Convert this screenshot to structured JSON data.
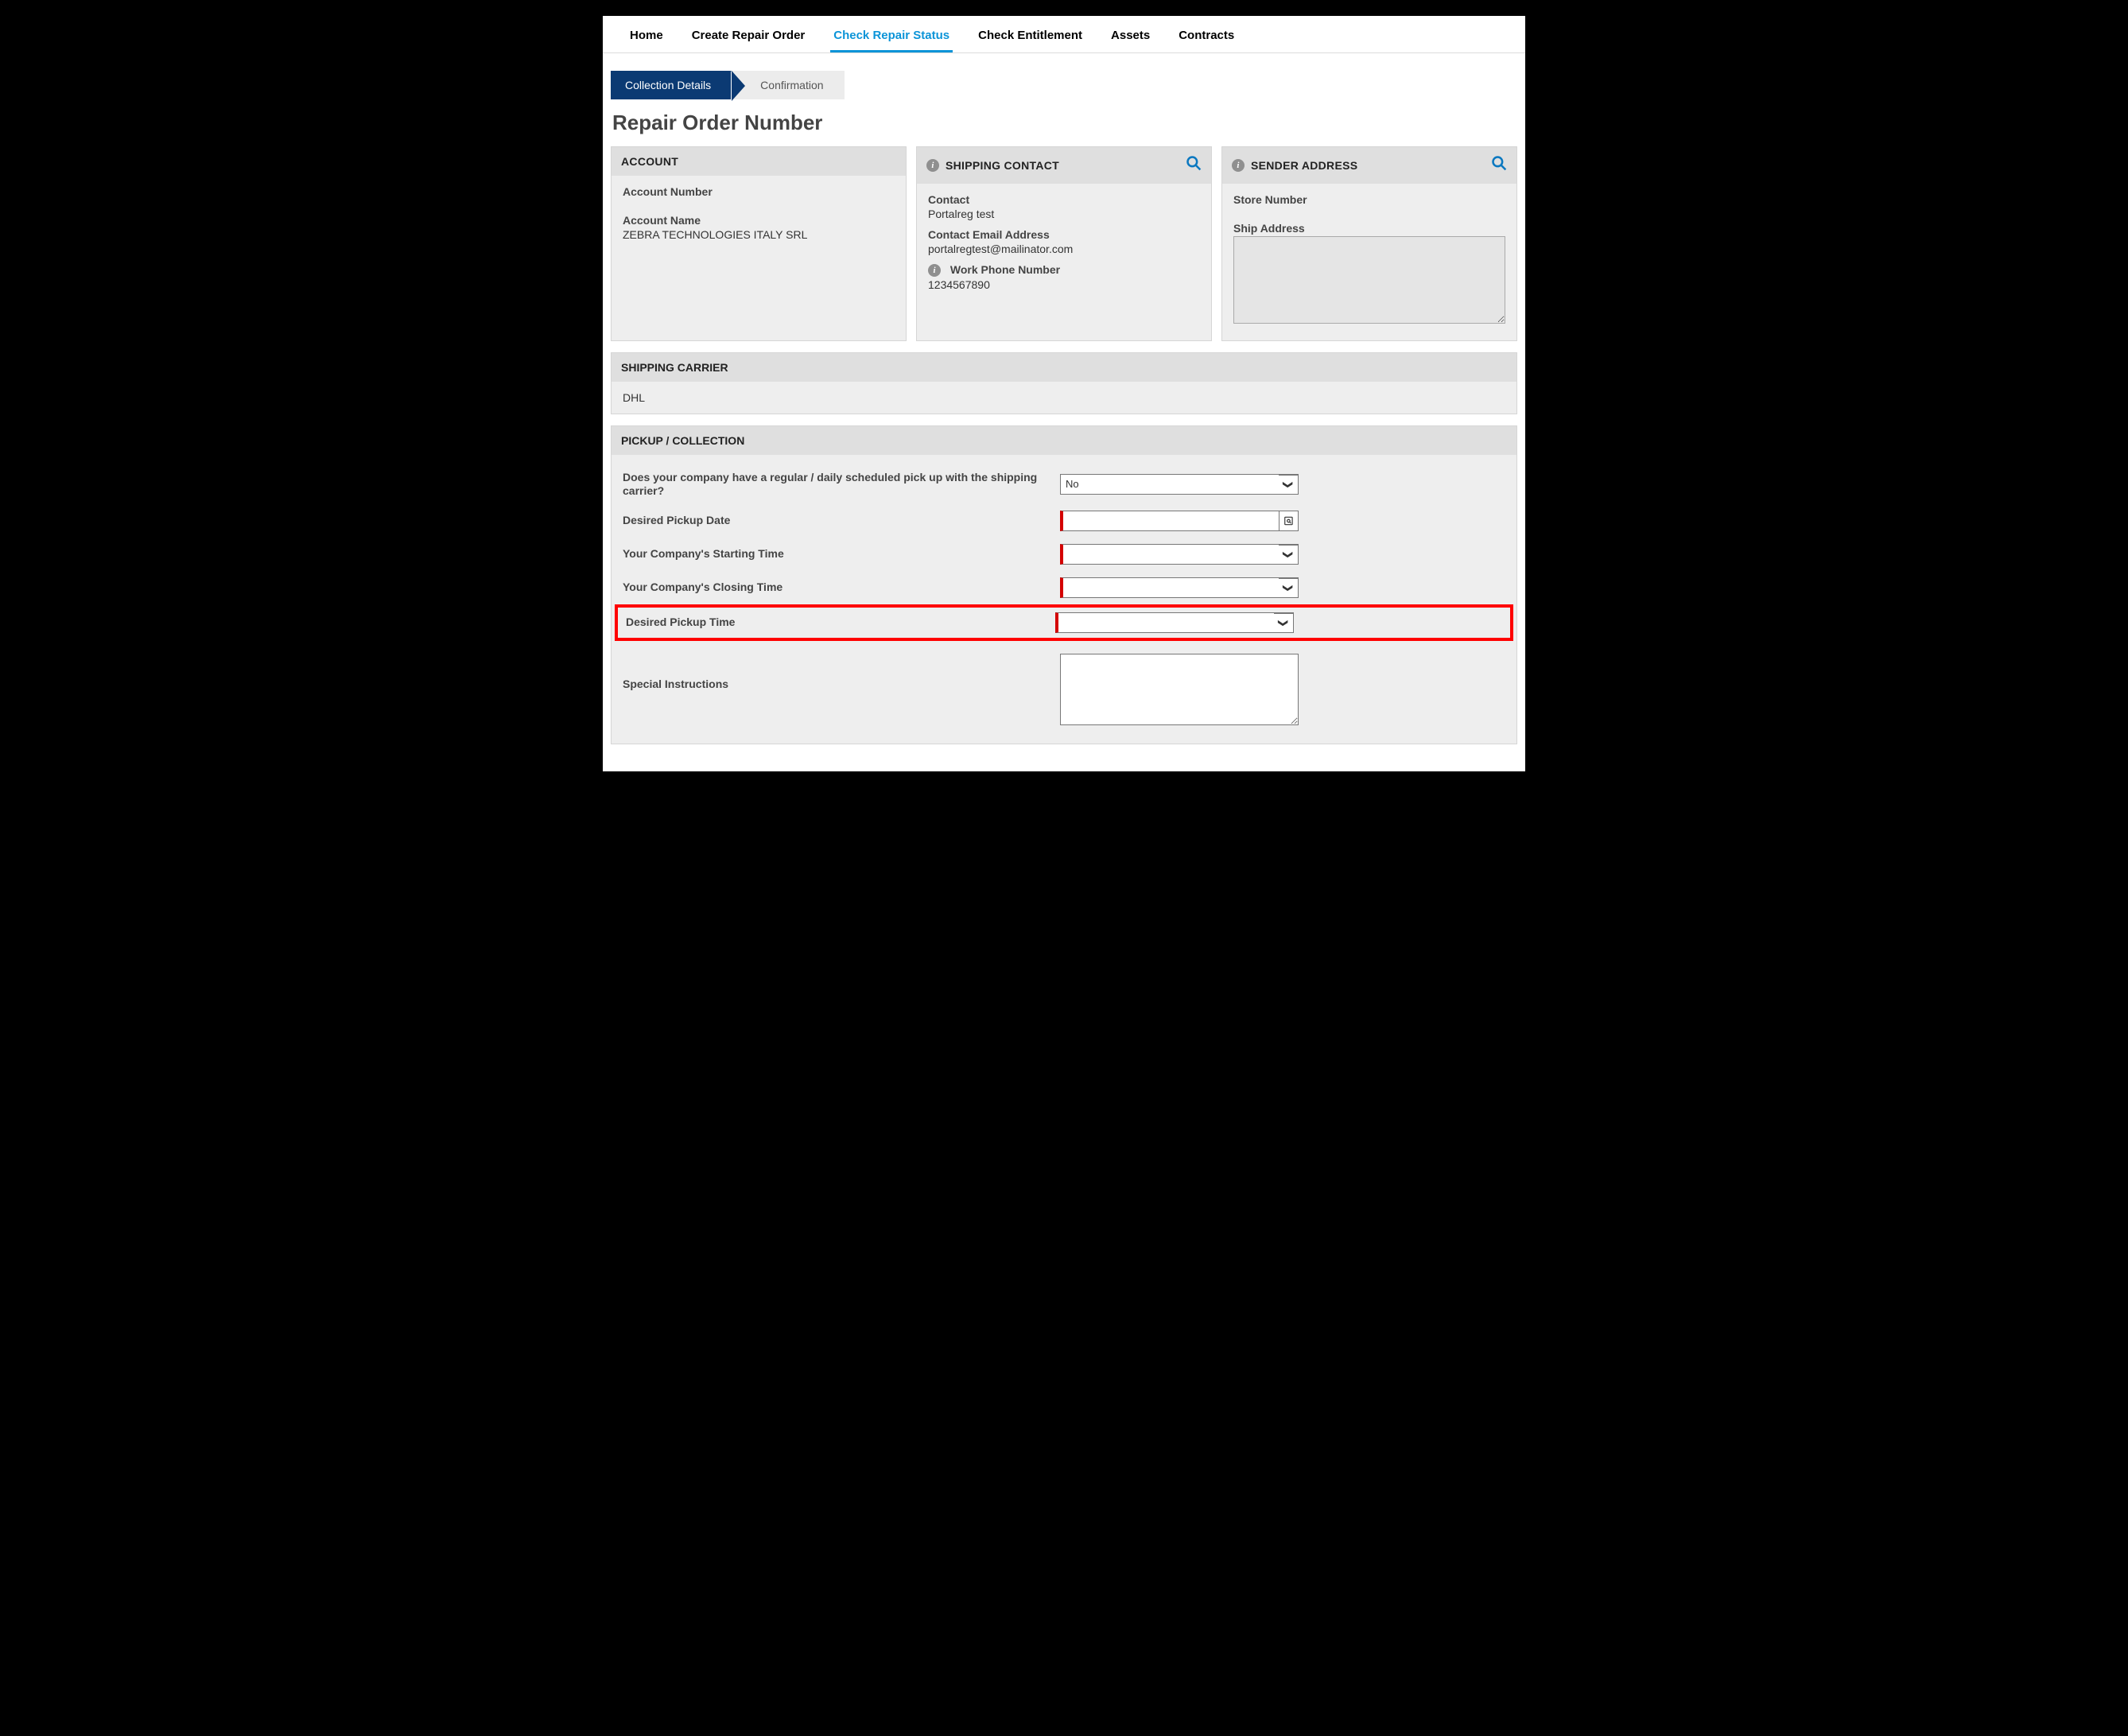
{
  "topnav": {
    "items": [
      {
        "label": "Home"
      },
      {
        "label": "Create Repair Order"
      },
      {
        "label": "Check Repair Status"
      },
      {
        "label": "Check Entitlement"
      },
      {
        "label": "Assets"
      },
      {
        "label": "Contracts"
      }
    ],
    "active_index": 2
  },
  "wizard": {
    "steps": [
      {
        "label": "Collection Details"
      },
      {
        "label": "Confirmation"
      }
    ],
    "active_index": 0
  },
  "page_title": "Repair Order Number",
  "account": {
    "header": "ACCOUNT",
    "number_label": "Account Number",
    "number_value": "",
    "name_label": "Account Name",
    "name_value": "ZEBRA TECHNOLOGIES ITALY SRL"
  },
  "shipping_contact": {
    "header": "SHIPPING CONTACT",
    "contact_label": "Contact",
    "contact_value": "Portalreg test",
    "email_label": "Contact Email Address",
    "email_value": "portalregtest@mailinator.com",
    "phone_label": "Work Phone Number",
    "phone_value": "1234567890"
  },
  "sender_address": {
    "header": "SENDER ADDRESS",
    "store_label": "Store Number",
    "store_value": "",
    "ship_label": "Ship Address",
    "ship_value": ""
  },
  "shipping_carrier": {
    "header": "SHIPPING CARRIER",
    "value": "DHL"
  },
  "pickup": {
    "header": "PICKUP / COLLECTION",
    "regular_label": "Does your company have a regular / daily scheduled pick up with the shipping carrier?",
    "regular_value": "No",
    "date_label": "Desired Pickup Date",
    "date_value": "",
    "start_label": "Your Company's Starting Time",
    "start_value": "",
    "close_label": "Your Company's Closing Time",
    "close_value": "",
    "time_label": "Desired Pickup Time",
    "time_value": "",
    "instructions_label": "Special Instructions",
    "instructions_value": ""
  },
  "icons": {
    "info": "i",
    "chevron": "❯"
  }
}
